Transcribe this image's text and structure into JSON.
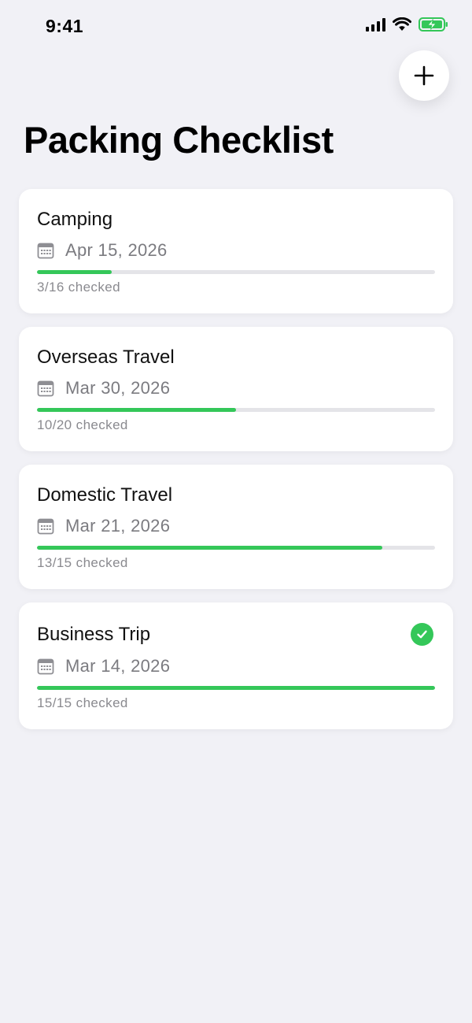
{
  "status_bar": {
    "time": "9:41",
    "icons": [
      "cellular-signal-icon",
      "wifi-icon",
      "battery-charging-icon"
    ],
    "battery_color": "#34c759"
  },
  "header": {
    "title": "Packing Checklist",
    "add_icon": "plus-icon"
  },
  "colors": {
    "background": "#f1f1f6",
    "card": "#ffffff",
    "progress_fill": "#34c759",
    "progress_track": "#e4e4e8",
    "secondary_text": "#7b7b80"
  },
  "checklists": [
    {
      "title": "Camping",
      "date": "Apr 15, 2026",
      "checked": 3,
      "total": 16,
      "progress_label": "3/16 checked",
      "completed": false
    },
    {
      "title": "Overseas Travel",
      "date": "Mar 30, 2026",
      "checked": 10,
      "total": 20,
      "progress_label": "10/20 checked",
      "completed": false
    },
    {
      "title": "Domestic Travel",
      "date": "Mar 21, 2026",
      "checked": 13,
      "total": 15,
      "progress_label": "13/15 checked",
      "completed": false
    },
    {
      "title": "Business Trip",
      "date": "Mar 14, 2026",
      "checked": 15,
      "total": 15,
      "progress_label": "15/15 checked",
      "completed": true
    }
  ]
}
